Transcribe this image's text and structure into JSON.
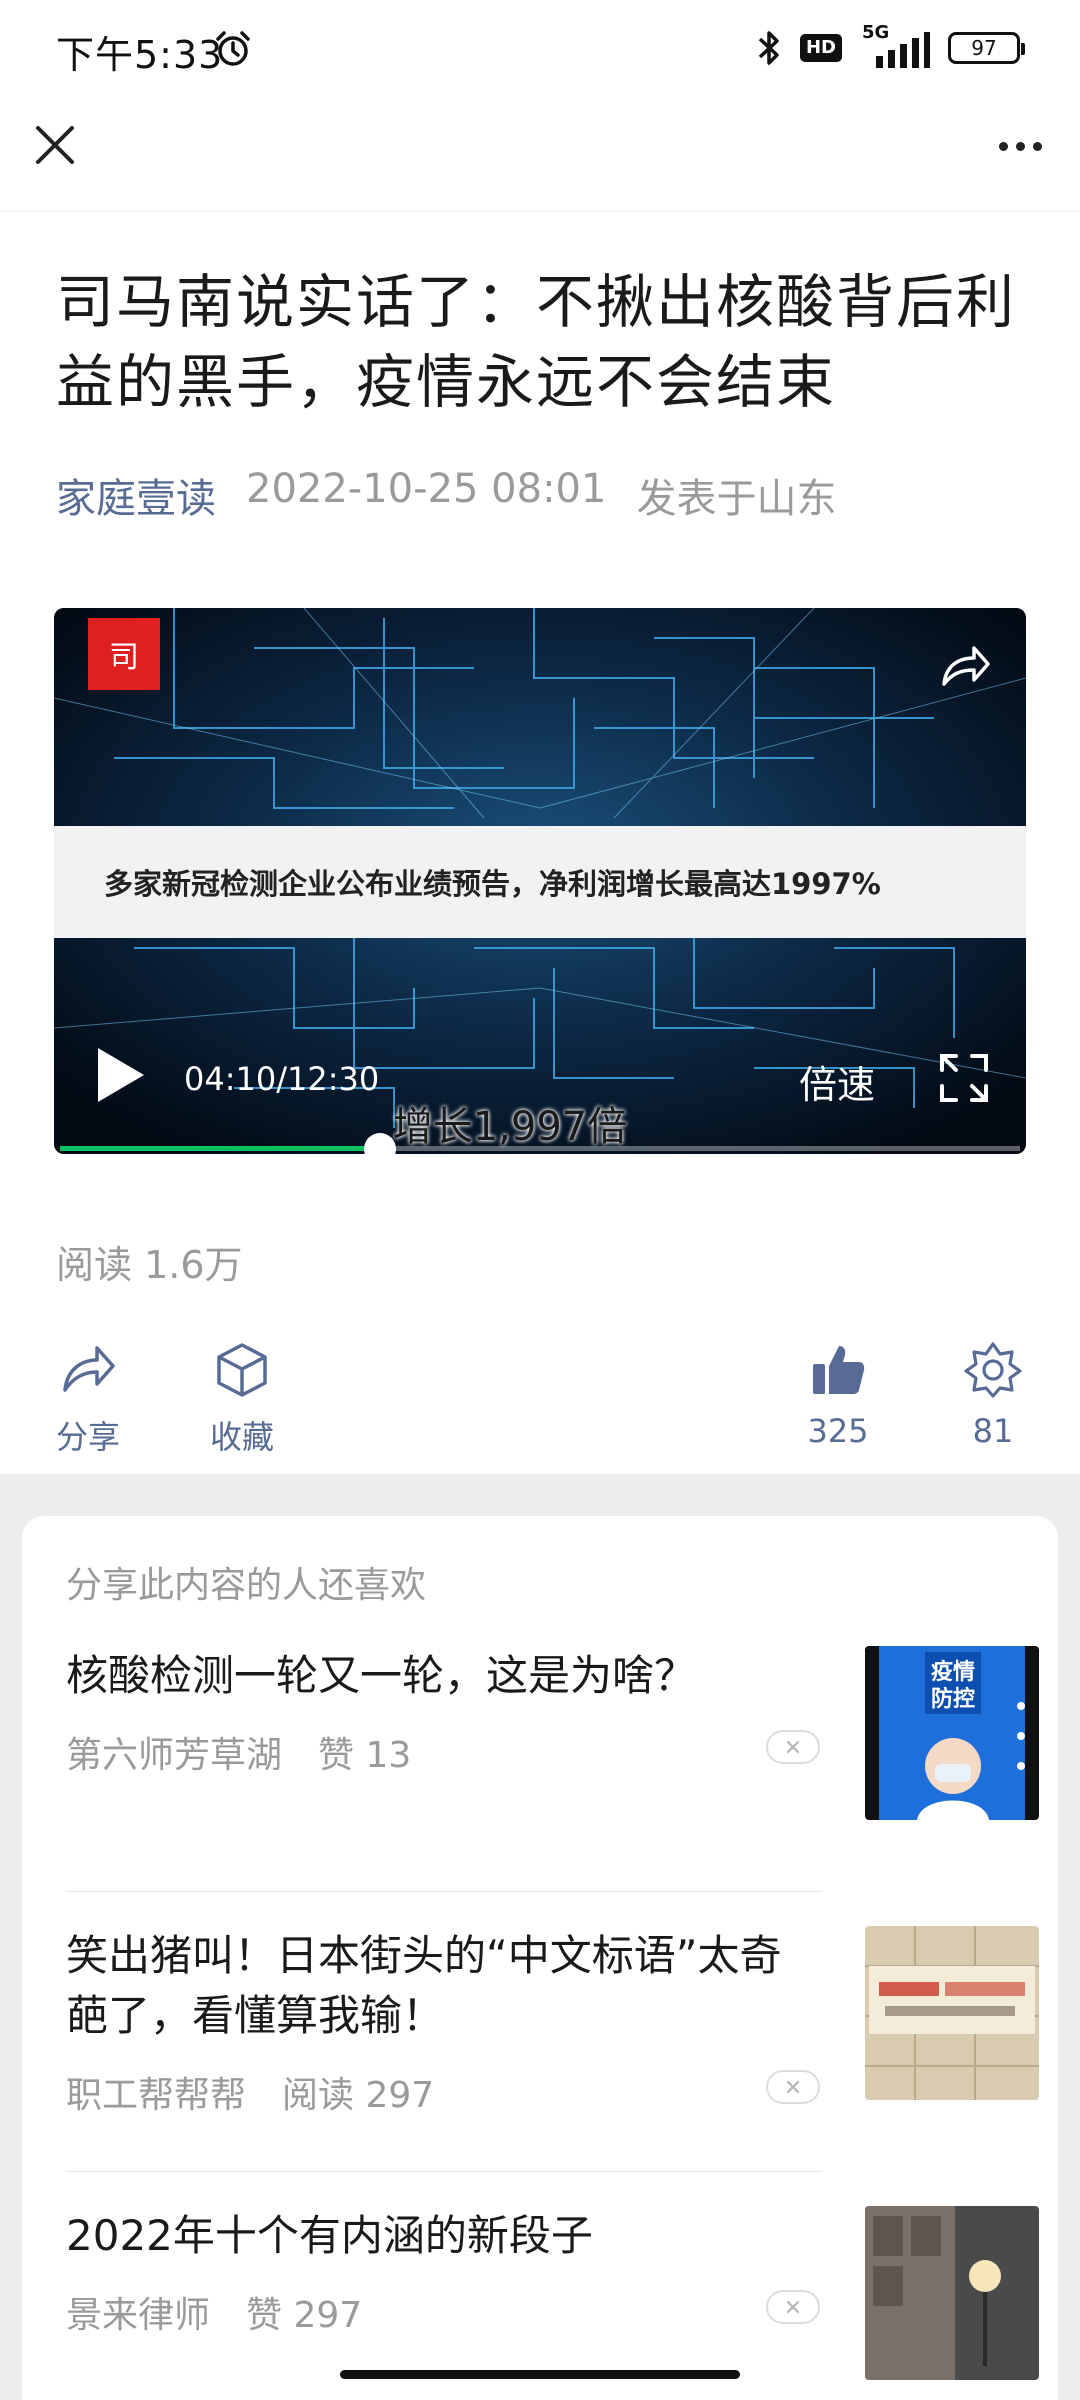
{
  "status_bar": {
    "time": "下午5:33",
    "hd": "HD",
    "network": "5G",
    "battery": "97"
  },
  "article": {
    "title": "司马南说实话了：不揪出核酸背后利益的黑手，疫情永远不会结束",
    "author": "家庭壹读",
    "datetime": "2022-10-25 08:01",
    "location": "发表于山东"
  },
  "video": {
    "logo_text": "司",
    "caption": "多家新冠检测企业公布业绩预告，净利润增长最高达1997%",
    "time": "04:10/12:30",
    "speed_label": "倍速",
    "subtitle": "增长1,997倍",
    "progress": 0.333
  },
  "read_count": "阅读 1.6万",
  "actions": {
    "share": "分享",
    "favorite": "收藏",
    "like_count": "325",
    "wow_count": "81"
  },
  "recommendations": {
    "heading": "分享此内容的人还喜欢",
    "items": [
      {
        "title": "核酸检测一轮又一轮，这是为啥？",
        "source": "第六师芳草湖",
        "stat": "赞 13"
      },
      {
        "title": "笑出猪叫！日本街头的“中文标语”太奇葩了，看懂算我输！",
        "source": "职工帮帮帮",
        "stat": "阅读 297"
      },
      {
        "title": "2022年十个有内涵的新段子",
        "source": "景来律师",
        "stat": "赞 297"
      }
    ],
    "thumb1_text": "疫情防控"
  },
  "colors": {
    "link_blue": "#576b95",
    "progress_green": "#07c160",
    "meta_gray": "#9a9a9a"
  },
  "icons": [
    "alarm-icon",
    "bluetooth-icon",
    "signal-icon",
    "close-icon",
    "more-icon",
    "share-arrow-icon",
    "play-icon",
    "fullscreen-icon",
    "share-icon",
    "favorite-icon",
    "like-icon",
    "wow-icon",
    "dismiss-icon"
  ]
}
